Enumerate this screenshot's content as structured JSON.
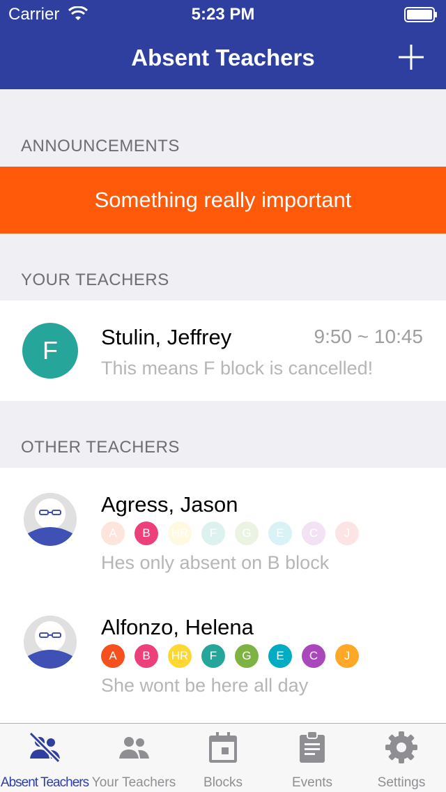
{
  "status_bar": {
    "carrier": "Carrier",
    "time": "5:23 PM"
  },
  "nav": {
    "title": "Absent Teachers"
  },
  "sections": {
    "announcements": "ANNOUNCEMENTS",
    "your_teachers": "YOUR TEACHERS",
    "other_teachers": "OTHER TEACHERS"
  },
  "announcement": {
    "text": "Something really important"
  },
  "your_teachers": [
    {
      "block_letter": "F",
      "name": "Stulin, Jeffrey",
      "time": "9:50 ~ 10:45",
      "note": "This means F block is cancelled!",
      "block_color": "#26a69a"
    }
  ],
  "other_teachers": [
    {
      "name": "Agress, Jason",
      "note": "Hes only absent on B block",
      "blocks": [
        {
          "label": "A",
          "color": "#f4511e",
          "absent": false
        },
        {
          "label": "B",
          "color": "#ec407a",
          "absent": true
        },
        {
          "label": "HR",
          "color": "#fdd835",
          "absent": false
        },
        {
          "label": "F",
          "color": "#26a69a",
          "absent": false
        },
        {
          "label": "G",
          "color": "#7cb342",
          "absent": false
        },
        {
          "label": "E",
          "color": "#00acc1",
          "absent": false
        },
        {
          "label": "C",
          "color": "#ab47bc",
          "absent": false
        },
        {
          "label": "J",
          "color": "#ef5350",
          "absent": false
        }
      ]
    },
    {
      "name": "Alfonzo, Helena",
      "note": "She wont be here all day",
      "blocks": [
        {
          "label": "A",
          "color": "#f4511e",
          "absent": true
        },
        {
          "label": "B",
          "color": "#ec407a",
          "absent": true
        },
        {
          "label": "HR",
          "color": "#fdd835",
          "absent": true
        },
        {
          "label": "F",
          "color": "#26a69a",
          "absent": true
        },
        {
          "label": "G",
          "color": "#7cb342",
          "absent": true
        },
        {
          "label": "E",
          "color": "#00acc1",
          "absent": true
        },
        {
          "label": "C",
          "color": "#ab47bc",
          "absent": true
        },
        {
          "label": "J",
          "color": "#ffa726",
          "absent": true
        }
      ]
    }
  ],
  "tabs": [
    {
      "label": "Absent Teachers",
      "icon": "absent-teachers-icon",
      "active": true
    },
    {
      "label": "Your Teachers",
      "icon": "people-icon",
      "active": false
    },
    {
      "label": "Blocks",
      "icon": "calendar-icon",
      "active": false
    },
    {
      "label": "Events",
      "icon": "clipboard-icon",
      "active": false
    },
    {
      "label": "Settings",
      "icon": "gear-icon",
      "active": false
    }
  ],
  "colors": {
    "nav": "#2f3f9f",
    "announcement": "#ff5a0a",
    "tab_active": "#2f3f9f",
    "tab_inactive": "#8e8e93"
  }
}
